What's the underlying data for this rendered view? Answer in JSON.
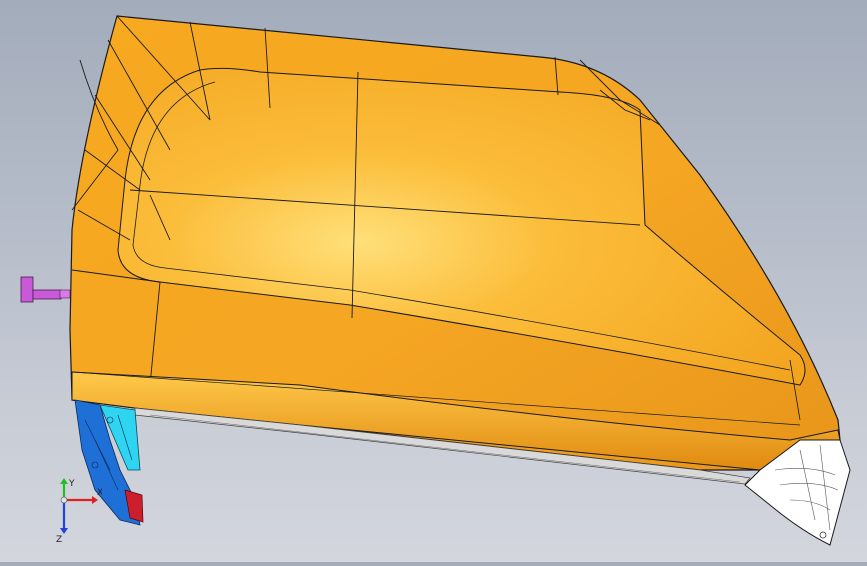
{
  "viewport": {
    "background_top": "#a3acbb",
    "background_bottom": "#d3d6dd"
  },
  "model": {
    "shell_color": "#f5a623",
    "shell_highlight": "#ffd36a",
    "shell_shadow": "#d98a0c",
    "edge_color": "#1a1a1a",
    "cyan_part_color": "#2fd4f0",
    "blue_part_color": "#1e6fd6",
    "red_part_color": "#cc1f2e",
    "magenta_part_color": "#c85ad8",
    "white_part_color": "#ffffff"
  },
  "triad": {
    "x_label": "X",
    "y_label": "Y",
    "z_label": "Z",
    "x_color": "#e02020",
    "y_color": "#20c020",
    "z_color": "#2040e0"
  }
}
